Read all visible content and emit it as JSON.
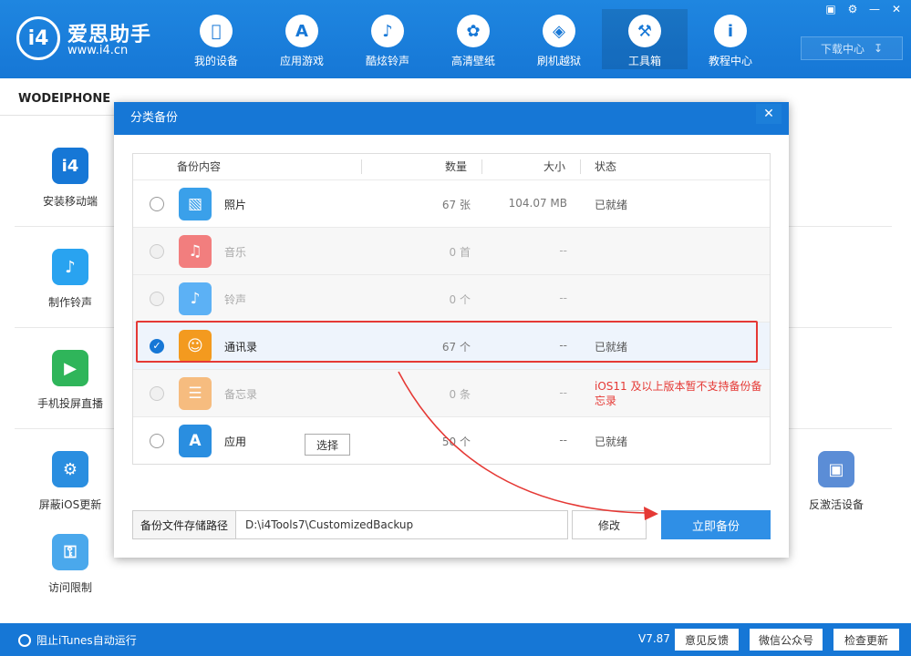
{
  "header": {
    "brand_name": "爱思助手",
    "brand_url": "www.i4.cn",
    "logo_text": "i4",
    "nav": [
      {
        "label": "我的设备",
        "icon": "apple-icon",
        "glyph": ""
      },
      {
        "label": "应用游戏",
        "icon": "app-store-icon",
        "glyph": "A"
      },
      {
        "label": "酷炫铃声",
        "icon": "bell-icon",
        "glyph": "♪"
      },
      {
        "label": "高清壁纸",
        "icon": "flower-icon",
        "glyph": "✿"
      },
      {
        "label": "刷机越狱",
        "icon": "box-icon",
        "glyph": "◈"
      },
      {
        "label": "工具箱",
        "icon": "tools-icon",
        "glyph": "⚒"
      },
      {
        "label": "教程中心",
        "icon": "info-icon",
        "glyph": "i"
      }
    ],
    "download_label": "下载中心"
  },
  "sidebar": {
    "device_name": "WODEIPHONE",
    "tools": [
      {
        "label": "安装移动端",
        "color": "#1677d6",
        "glyph": "i4"
      },
      {
        "label": "制作铃声",
        "color": "#29a3f0",
        "glyph": "♪"
      },
      {
        "label": "手机投屏直播",
        "color": "#2fb55a",
        "glyph": "▶"
      },
      {
        "label": "屏蔽iOS更新",
        "color": "#2a8ee0",
        "glyph": "⚙"
      },
      {
        "label": "访问限制",
        "color": "#4aa8ec",
        "glyph": "⚿"
      },
      {
        "label": "反激活设备",
        "color": "#5b8dd6",
        "glyph": "▣"
      }
    ]
  },
  "dialog": {
    "title": "分类备份",
    "columns": {
      "content": "备份内容",
      "count": "数量",
      "size": "大小",
      "status": "状态"
    },
    "rows": [
      {
        "name": "照片",
        "count": "67 张",
        "size": "104.07 MB",
        "status": "已就绪",
        "icon": "photo-icon",
        "color": "#3aa0ea",
        "glyph": "▧"
      },
      {
        "name": "音乐",
        "count": "0 首",
        "size": "--",
        "status": "",
        "icon": "music-icon",
        "color": "#f26a6a",
        "glyph": "♫"
      },
      {
        "name": "铃声",
        "count": "0 个",
        "size": "--",
        "status": "",
        "icon": "bell-icon",
        "color": "#42a5f5",
        "glyph": "♪"
      },
      {
        "name": "通讯录",
        "count": "67 个",
        "size": "--",
        "status": "已就绪",
        "icon": "contacts-icon",
        "color": "#f39a1f",
        "glyph": "☺"
      },
      {
        "name": "备忘录",
        "count": "0 条",
        "size": "--",
        "status": "iOS11 及以上版本暂不支持备份备忘录",
        "icon": "notes-icon",
        "color": "#f6b26b",
        "glyph": "☰"
      },
      {
        "name": "应用",
        "count": "50 个",
        "size": "--",
        "status": "已就绪",
        "icon": "app-store-icon",
        "color": "#2a8ee0",
        "glyph": "A"
      }
    ],
    "choose_label": "选择",
    "path_label": "备份文件存储路径",
    "path_value": "D:\\i4Tools7\\CustomizedBackup",
    "modify_label": "修改",
    "backup_label": "立即备份",
    "close_glyph": "✕"
  },
  "statusbar": {
    "itunes_label": "阻止iTunes自动运行",
    "version": "V7.87",
    "feedback": "意见反馈",
    "wechat": "微信公众号",
    "update": "检查更新"
  },
  "colors": {
    "primary": "#1677d6",
    "highlight": "#e53935",
    "warning_text": "#e53935"
  }
}
